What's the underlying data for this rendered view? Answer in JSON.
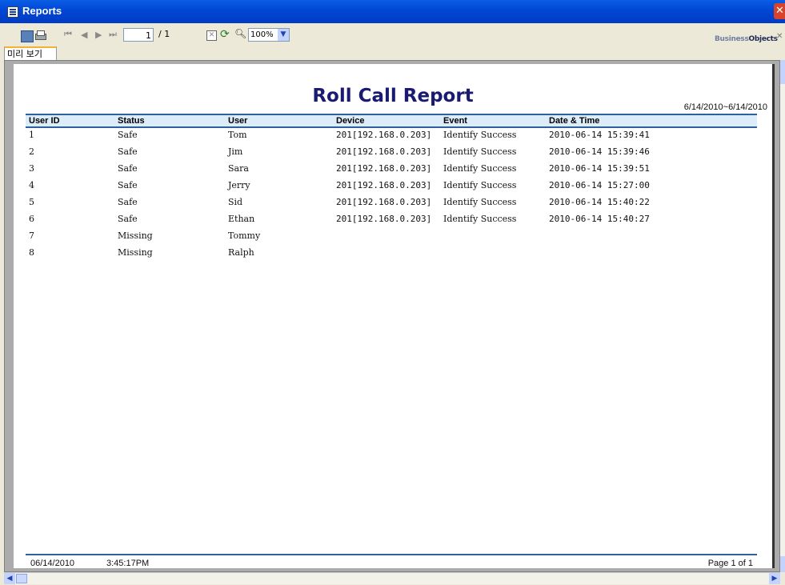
{
  "window": {
    "title": "Reports",
    "close_glyph": "✕"
  },
  "toolbar": {
    "page_current": "1",
    "page_total": "/ 1",
    "zoom": "100%",
    "logo_prefix": "Business",
    "logo_suffix": "Objects",
    "nav_first": "⏮",
    "nav_prev": "◀",
    "nav_next": "▶",
    "nav_last": "⏭",
    "close_glyph": "✕"
  },
  "tab": {
    "label": "미리 보기"
  },
  "report": {
    "title": "Roll Call Report",
    "date_range": "6/14/2010~6/14/2010",
    "columns": [
      "User ID",
      "Status",
      "User",
      "Device",
      "Event",
      "Date & Time"
    ],
    "rows": [
      {
        "id": "1",
        "status": "Safe",
        "user": "Tom",
        "device": "201[192.168.0.203]",
        "event": "Identify Success",
        "datetime": "2010-06-14 15:39:41"
      },
      {
        "id": "2",
        "status": "Safe",
        "user": "Jim",
        "device": "201[192.168.0.203]",
        "event": "Identify Success",
        "datetime": "2010-06-14 15:39:46"
      },
      {
        "id": "3",
        "status": "Safe",
        "user": "Sara",
        "device": "201[192.168.0.203]",
        "event": "Identify Success",
        "datetime": "2010-06-14 15:39:51"
      },
      {
        "id": "4",
        "status": "Safe",
        "user": "Jerry",
        "device": "201[192.168.0.203]",
        "event": "Identify Success",
        "datetime": "2010-06-14 15:27:00"
      },
      {
        "id": "5",
        "status": "Safe",
        "user": "Sid",
        "device": "201[192.168.0.203]",
        "event": "Identify Success",
        "datetime": "2010-06-14 15:40:22"
      },
      {
        "id": "6",
        "status": "Safe",
        "user": "Ethan",
        "device": "201[192.168.0.203]",
        "event": "Identify Success",
        "datetime": "2010-06-14 15:40:27"
      },
      {
        "id": "7",
        "status": "Missing",
        "user": "Tommy",
        "device": "",
        "event": "",
        "datetime": ""
      },
      {
        "id": "8",
        "status": "Missing",
        "user": "Ralph",
        "device": "",
        "event": "",
        "datetime": ""
      }
    ],
    "footer": {
      "date": "06/14/2010",
      "time": "3:45:17PM",
      "page": "Page 1 of 1"
    }
  }
}
